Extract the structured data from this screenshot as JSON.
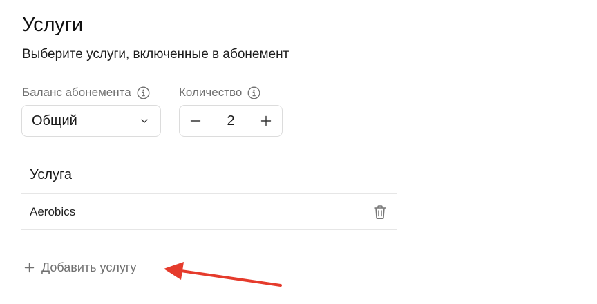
{
  "section": {
    "title": "Услуги",
    "subtitle": "Выберите услуги, включенные в абонемент"
  },
  "balance": {
    "label": "Баланс абонемента",
    "selected": "Общий",
    "info_icon": "info-circle-icon",
    "dropdown_icon": "chevron-down-icon"
  },
  "quantity": {
    "label": "Количество",
    "value": "2",
    "info_icon": "info-circle-icon",
    "decrement_icon": "minus-icon",
    "increment_icon": "plus-icon"
  },
  "table": {
    "header": "Услуга",
    "rows": [
      {
        "name": "Aerobics",
        "action_icon": "trash-icon"
      }
    ]
  },
  "add_service": {
    "label": "Добавить услугу",
    "icon": "plus-icon"
  },
  "annotation": {
    "type": "arrow",
    "color": "#e53b2c"
  },
  "colors": {
    "text_primary": "#1a1a1a",
    "text_muted": "#707070",
    "border": "#dcdcdc",
    "divider": "#e6e6e6"
  }
}
